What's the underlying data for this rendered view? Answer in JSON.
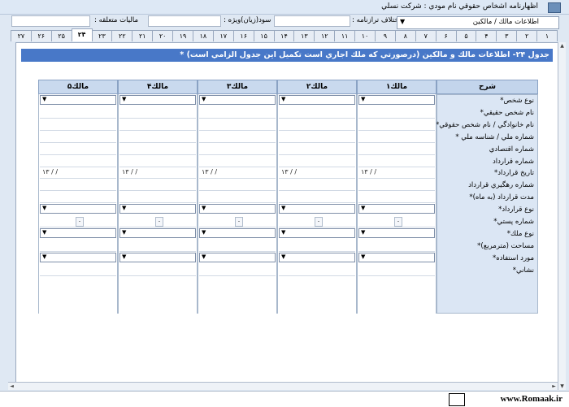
{
  "window": {
    "title": "اظهارنامه اشخاص حقوقي   نام مودي : شركت نسلي"
  },
  "infobar": {
    "tax_label": "ماليات متعلقه :",
    "profit_label": "سود(زيان)ويژه :",
    "diff_label": "اختلاف ترازنامه :"
  },
  "sheet_selector": {
    "value": "اطلاعات مالك / مالكين"
  },
  "tabs": [
    "۱",
    "۲",
    "۳",
    "۴",
    "۵",
    "۶",
    "۷",
    "۸",
    "۹",
    "۱۰",
    "۱۱",
    "۱۲",
    "۱۳",
    "۱۴",
    "۱۵",
    "۱۶",
    "۱۷",
    "۱۸",
    "۱۹",
    "۲۰",
    "۲۱",
    "۲۲",
    "۲۳",
    "۲۴",
    "۲۵",
    "۲۶",
    "۲۷"
  ],
  "active_tab": "۲۴",
  "heading": "جدول ۲۴-  اطلاعات مالك و مالكين (درصورتي كه ملك اجاري است تكميل اين جدول الزامي است) *",
  "table": {
    "desc_header": "شرح",
    "owners": [
      "مالك۱",
      "مالك۲",
      "مالك۳",
      "مالك۴",
      "مالك۵"
    ],
    "rows": [
      "نوع شخص*",
      "نام شخص حقيقي*",
      "نام خانوادگي / نام شخص حقوقي*",
      "شماره ملي / شناسه ملي *",
      "شماره اقتصادي",
      "شماره قرارداد",
      "تاريخ قرارداد*",
      "شماره رهگيري قرارداد",
      "مدت قرارداد (به ماه)*",
      "نوع قرارداد*",
      "شماره پستي*",
      "نوع ملك*",
      "مساحت (مترمربع)*",
      "مورد استفاده*",
      "نشاني*"
    ],
    "date_placeholder": "۱۳  /    /",
    "postal_sep": "-"
  },
  "brand": {
    "site": "www.Romaak.ir"
  }
}
